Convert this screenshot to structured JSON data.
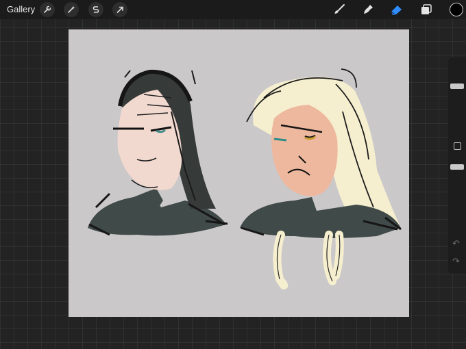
{
  "topbar": {
    "gallery_label": "Gallery",
    "left_tools": [
      "wrench-icon",
      "magic-wand-icon",
      "selection-s-icon",
      "transform-arrow-icon"
    ],
    "right_tools": [
      "brush-icon",
      "smudge-icon",
      "eraser-icon",
      "layers-icon"
    ],
    "active_tool": "eraser-icon",
    "current_color": "#000000"
  },
  "canvas": {
    "background_color": "#cbc8c9",
    "artwork": [
      "dark-haired-bust-sketch",
      "blonde-haired-bust-sketch"
    ]
  },
  "sidebar": {
    "brush_size_level": 0.1,
    "opacity_level": 0.9,
    "undo_icon": "undo-icon",
    "redo_icon": "redo-icon"
  },
  "colors": {
    "accent_blue": "#2f8cff",
    "toolbar_bg": "#1b1b1b",
    "workspace_bg": "#232323"
  }
}
